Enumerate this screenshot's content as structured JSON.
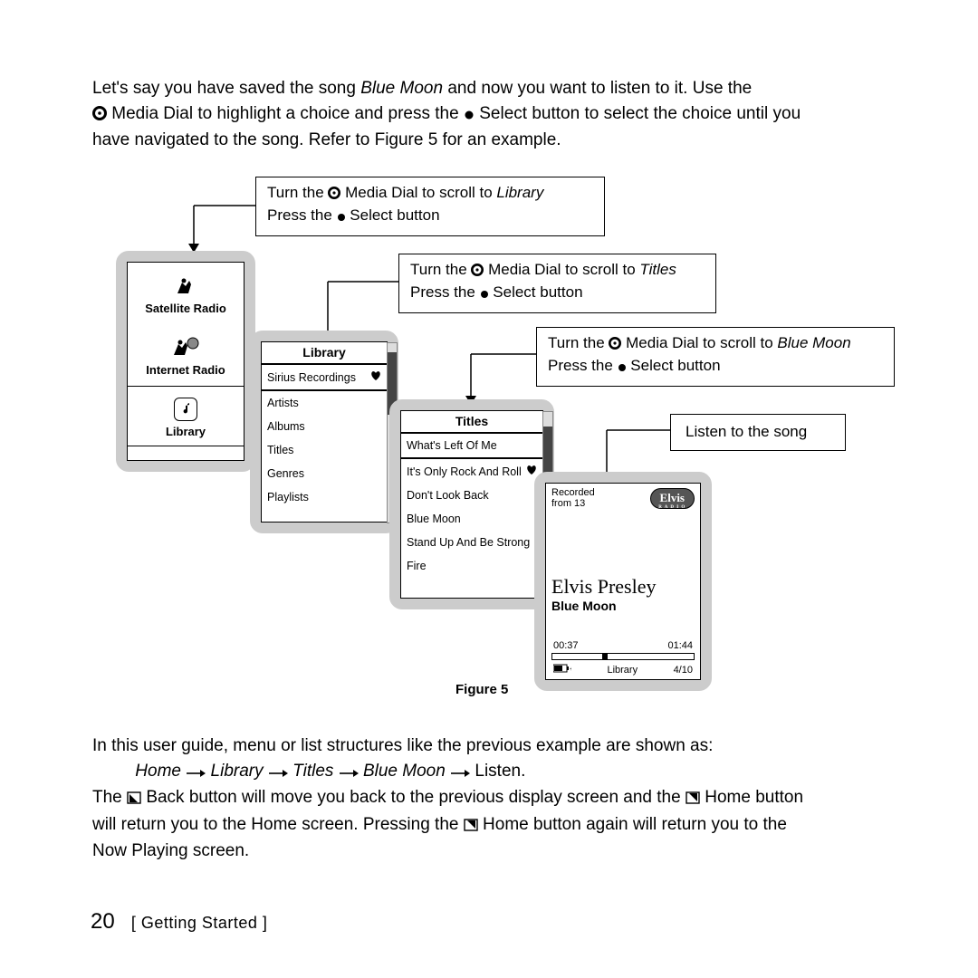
{
  "intro": {
    "line1a": "Let's say you have saved the song ",
    "song_italic": "Blue Moon",
    "line1b": " and now you want to listen to it. Use the",
    "line2a": "Media Dial to highlight a choice and press the ",
    "line2b": " Select button to select the choice until you",
    "line3": "have navigated to the song. Refer to Figure 5 for an example."
  },
  "callouts": {
    "c1a": "Turn the ",
    "c1b": " Media Dial to scroll to ",
    "c1c": "Library",
    "c1_press": "Press the ",
    "c1_press2": " Select button",
    "c2a": "Turn the ",
    "c2b": " Media Dial to scroll to ",
    "c2c": "Titles",
    "c2_press": "Press the ",
    "c2_press2": " Select button",
    "c3a": "Turn the ",
    "c3b": " Media Dial to scroll to ",
    "c3c": "Blue Moon",
    "c3_press": "Press the ",
    "c3_press2": " Select button",
    "c4": "Listen to the song"
  },
  "home_panel": {
    "item1": "Satellite Radio",
    "item2": "Internet Radio",
    "item3": "Library"
  },
  "library_panel": {
    "header": "Library",
    "items": [
      "Sirius Recordings",
      "Artists",
      "Albums",
      "Titles",
      "Genres",
      "Playlists"
    ]
  },
  "titles_panel": {
    "header": "Titles",
    "items": [
      "What's Left Of Me",
      "It's Only Rock And Roll",
      "Don't Look Back",
      "Blue Moon",
      "Stand Up And Be Strong",
      "Fire"
    ]
  },
  "nowplaying_panel": {
    "recorded_label": "Recorded from 13",
    "logo_text": "Elvis",
    "artist": "Elvis Presley",
    "song": "Blue Moon",
    "time_elapsed": "00:37",
    "time_total": "01:44",
    "bottom_center": "Library",
    "bottom_right": "4/10"
  },
  "figure_caption": "Figure 5",
  "para2": {
    "line1": "In this user guide, menu or list structures like the previous example are shown as:",
    "breadcrumb": {
      "home": "Home",
      "library": "Library",
      "titles": "Titles",
      "bluemoon": "Blue Moon",
      "listen": "Listen."
    },
    "line3a": "The ",
    "line3b": " Back button will move you back to the previous display screen and the ",
    "line3c": " Home button",
    "line4a": "will return you to the Home screen. Pressing the ",
    "line4b": " Home button again will return you to the",
    "line5": "Now Playing screen."
  },
  "footer": {
    "page": "20",
    "section": "Getting Started"
  }
}
